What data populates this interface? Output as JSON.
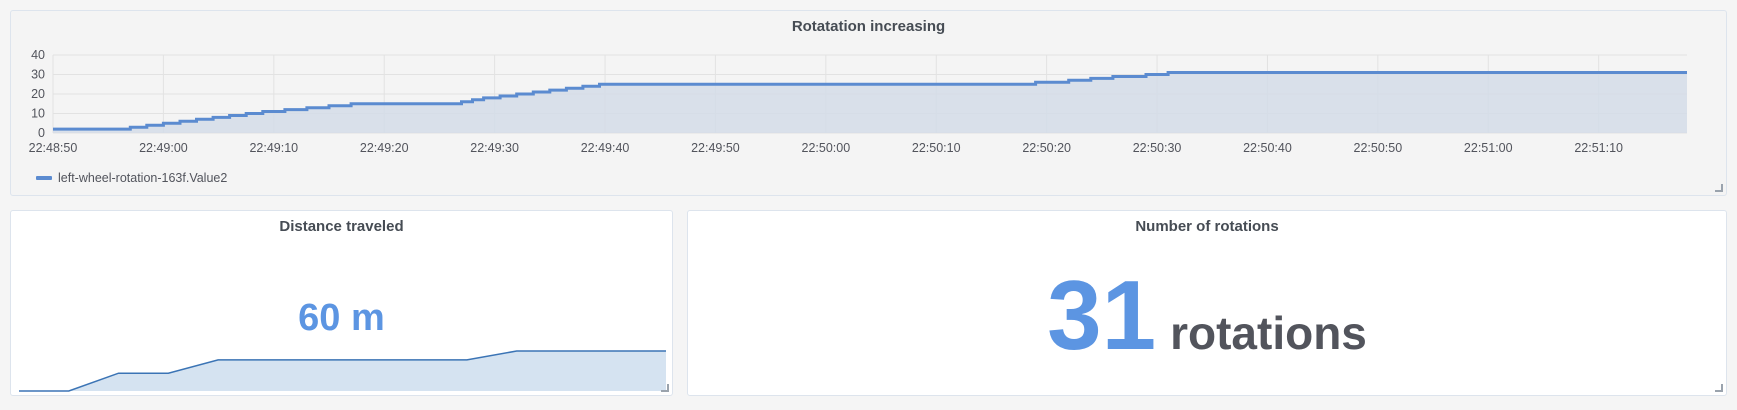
{
  "colors": {
    "series_line": "#5b8bd0",
    "series_fill": "#d3dce8",
    "stat_value": "#5c95e2",
    "spark_fill": "#d5e3f1",
    "spark_line": "#3b74b5"
  },
  "panels": {
    "top": {
      "title": "Rotatation increasing"
    },
    "distance": {
      "title": "Distance traveled",
      "value": "60",
      "unit": "m"
    },
    "rotations": {
      "title": "Number of rotations",
      "value": "31",
      "unit": "rotations"
    }
  },
  "chart_data": [
    {
      "type": "area",
      "title": "Rotatation increasing",
      "xlabel": "",
      "ylabel": "",
      "ylim": [
        0,
        40
      ],
      "yticks": [
        0,
        10,
        20,
        30,
        40
      ],
      "xticks": [
        "22:48:50",
        "22:49:00",
        "22:49:10",
        "22:49:20",
        "22:49:30",
        "22:49:40",
        "22:49:50",
        "22:50:00",
        "22:50:10",
        "22:50:20",
        "22:50:30",
        "22:50:40",
        "22:50:50",
        "22:51:00",
        "22:51:10"
      ],
      "xlim_seconds_after_22_48_50": [
        0,
        148
      ],
      "grid": true,
      "legend": "bottom-left",
      "step": true,
      "series": [
        {
          "name": "left-wheel-rotation-163f.Value2",
          "points": [
            [
              0,
              2
            ],
            [
              7,
              2
            ],
            [
              7,
              3
            ],
            [
              8.5,
              3
            ],
            [
              8.5,
              4
            ],
            [
              10,
              4
            ],
            [
              10,
              5
            ],
            [
              11.5,
              5
            ],
            [
              11.5,
              6
            ],
            [
              13,
              6
            ],
            [
              13,
              7
            ],
            [
              14.5,
              7
            ],
            [
              14.5,
              8
            ],
            [
              16,
              8
            ],
            [
              16,
              9
            ],
            [
              17.5,
              9
            ],
            [
              17.5,
              10
            ],
            [
              19,
              10
            ],
            [
              19,
              11
            ],
            [
              21,
              11
            ],
            [
              21,
              12
            ],
            [
              23,
              12
            ],
            [
              23,
              13
            ],
            [
              25,
              13
            ],
            [
              25,
              14
            ],
            [
              27,
              14
            ],
            [
              27,
              15
            ],
            [
              37,
              15
            ],
            [
              37,
              16
            ],
            [
              38,
              16
            ],
            [
              38,
              17
            ],
            [
              39,
              17
            ],
            [
              39,
              18
            ],
            [
              40.5,
              18
            ],
            [
              40.5,
              19
            ],
            [
              42,
              19
            ],
            [
              42,
              20
            ],
            [
              43.5,
              20
            ],
            [
              43.5,
              21
            ],
            [
              45,
              21
            ],
            [
              45,
              22
            ],
            [
              46.5,
              22
            ],
            [
              46.5,
              23
            ],
            [
              48,
              23
            ],
            [
              48,
              24
            ],
            [
              49.5,
              24
            ],
            [
              49.5,
              25
            ],
            [
              89,
              25
            ],
            [
              89,
              26
            ],
            [
              92,
              26
            ],
            [
              92,
              27
            ],
            [
              94,
              27
            ],
            [
              94,
              28
            ],
            [
              96,
              28
            ],
            [
              96,
              29
            ],
            [
              99,
              29
            ],
            [
              99,
              30
            ],
            [
              101,
              30
            ],
            [
              101,
              31
            ],
            [
              148,
              31
            ]
          ]
        }
      ]
    },
    {
      "type": "area",
      "title": "",
      "sparkline": true,
      "series": [
        {
          "name": "",
          "values": [
            0,
            0,
            8,
            8,
            14,
            14,
            14,
            14,
            14,
            14,
            18,
            18,
            18,
            18
          ]
        }
      ]
    }
  ]
}
